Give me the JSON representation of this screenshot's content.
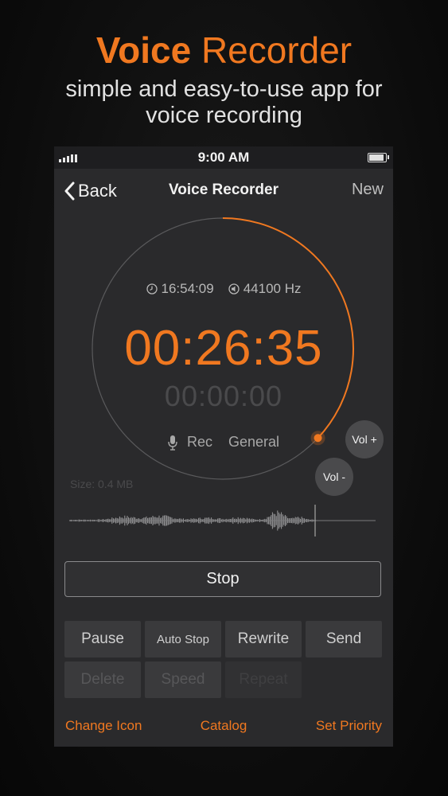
{
  "promo": {
    "title_bold": "Voice",
    "title_light": "Recorder",
    "subtitle_line1": "simple and easy-to-use app for",
    "subtitle_line2": "voice recording"
  },
  "status_bar": {
    "time": "9:00 AM",
    "battery_level": 1.0
  },
  "nav": {
    "back_label": "Back",
    "title": "Voice Recorder",
    "new_label": "New"
  },
  "recorder": {
    "clock_time": "16:54:09",
    "sample_rate": "44100 Hz",
    "elapsed_time": "00:26:35",
    "secondary_time": "00:00:00",
    "mode_label": "Rec",
    "category_label": "General",
    "size_label": "Size: 0.4 MB",
    "vol_plus_label": "Vol +",
    "vol_minus_label": "Vol -",
    "progress_fraction": 0.37
  },
  "controls": {
    "stop_label": "Stop",
    "row1": [
      "Pause",
      "Auto Stop",
      "Rewrite",
      "Send"
    ],
    "row2": [
      "Delete",
      "Speed",
      "Repeat",
      ""
    ]
  },
  "bottom_links": {
    "left": "Change Icon",
    "middle": "Catalog",
    "right": "Set Priority"
  },
  "colors": {
    "accent": "#f07820",
    "background": "#2a2a2c",
    "button": "#3a3a3c"
  },
  "icons": {
    "clock": "clock-icon",
    "sample_rate": "speaker-icon",
    "mic": "microphone-icon",
    "back": "chevron-left-icon"
  }
}
